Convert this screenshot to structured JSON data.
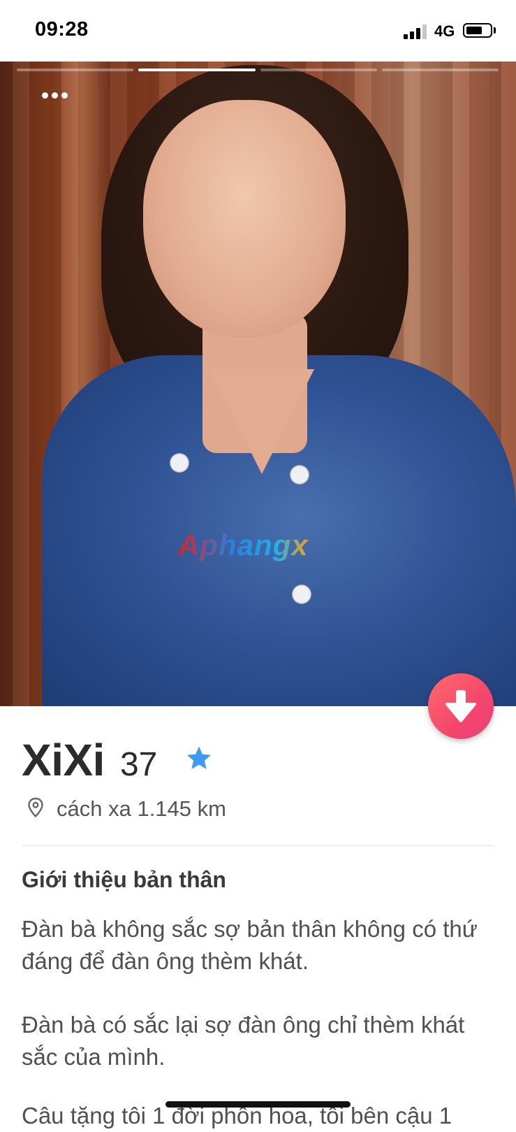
{
  "status_bar": {
    "time": "09:28",
    "network": "4G",
    "battery_level": 0.7,
    "signal_bars_filled": 3
  },
  "photo": {
    "page_count": 4,
    "active_page": 2,
    "watermark": "Aphangx"
  },
  "profile": {
    "name": "XiXi",
    "age": "37",
    "distance": "cách xa 1.145 km",
    "section_title": "Giới thiệu bản thân",
    "bio_paragraphs": [
      "Đàn bà không sắc sợ bản thân không có thứ đáng để đàn ông thèm khát.",
      "Đàn bà có sắc lại sợ đàn ông chỉ thèm khát sắc của mình.",
      "Câu tặng tôi 1 đời phồn hoa, tôi bên cậu 1"
    ]
  },
  "icons": {
    "more": "more-dots-icon",
    "down": "arrow-down-icon",
    "verified": "star-icon",
    "location": "location-pin-icon"
  },
  "colors": {
    "accent_gradient_start": "#ff6b6b",
    "accent_gradient_end": "#e83e7a",
    "verified_star": "#3e9bf1"
  }
}
